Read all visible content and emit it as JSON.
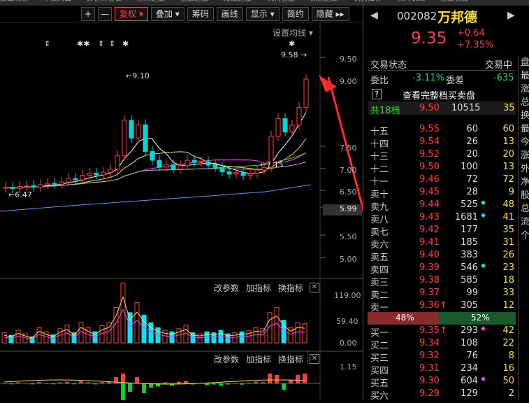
{
  "top_menu": [
    "盘面观测",
    "个股风云",
    "分析师看板",
    "东方选股",
    "信披选股",
    "短线选股",
    "机构看盘",
    "热点追踪",
    "机构推荐",
    "机构长线",
    "信披看盘"
  ],
  "toolbar": {
    "plus": "+",
    "minus": "—",
    "fuquan": "复权",
    "diejia": "叠加",
    "chouma": "筹码",
    "huaxian": "画线",
    "xianshi": "显示",
    "jianyue": "简约",
    "yincang": "隐藏"
  },
  "chart": {
    "settings_label": "设置均线",
    "price_axis": [
      "9.50",
      "9.00",
      "7.50",
      "7.00",
      "6.50",
      "5.99",
      "5.50",
      "5.00"
    ],
    "current_price_tag": "5.99",
    "annotations": {
      "high": "9.10",
      "low": "6.47",
      "low2": "7.15",
      "last": "9.58"
    },
    "markers": [
      "⇕",
      "✱✱",
      "⇕",
      "⇕",
      "✱",
      "✱"
    ],
    "vol_axis": [
      "119.00",
      "59.40",
      "0.00"
    ],
    "macd_axis": "1.15",
    "indicator_buttons": {
      "change": "改参数",
      "add": "加指标",
      "switch": "换指标",
      "close": "✕"
    }
  },
  "stock": {
    "code": "002082",
    "name": "万邦德",
    "price": "9.35",
    "change": "+0.64",
    "pct": "+7.35%"
  },
  "status": {
    "label": "交易状态",
    "value": "交易中"
  },
  "weibi": {
    "label": "委比",
    "value": "-3.11%",
    "cha_label": "委差",
    "cha_value": "-635"
  },
  "view_full": {
    "q": "?",
    "label": "查看完整档买卖盘"
  },
  "total": {
    "label": "共18档",
    "price": "9.50",
    "vol": "10515",
    "cnt": "35"
  },
  "asks": [
    {
      "n": "十五",
      "p": "9.55",
      "v": "60",
      "m": "",
      "c": "60"
    },
    {
      "n": "十四",
      "p": "9.54",
      "v": "26",
      "m": "",
      "c": "13"
    },
    {
      "n": "十三",
      "p": "9.52",
      "v": "20",
      "m": "",
      "c": "20"
    },
    {
      "n": "十二",
      "p": "9.50",
      "v": "100",
      "m": "",
      "c": "13"
    },
    {
      "n": "十一",
      "p": "9.46",
      "v": "72",
      "m": "",
      "c": "72"
    },
    {
      "n": "卖十",
      "p": "9.45",
      "v": "28",
      "m": "",
      "c": "9"
    },
    {
      "n": "卖九",
      "p": "9.44",
      "v": "525",
      "m": "◆",
      "c": "48"
    },
    {
      "n": "卖八",
      "p": "9.43",
      "v": "1681",
      "m": "◆",
      "c": "41"
    },
    {
      "n": "卖七",
      "p": "9.42",
      "v": "177",
      "m": "",
      "c": "35"
    },
    {
      "n": "卖六",
      "p": "9.41",
      "v": "185",
      "m": "",
      "c": "31"
    },
    {
      "n": "卖五",
      "p": "9.40",
      "v": "383",
      "m": "",
      "c": "26"
    },
    {
      "n": "卖四",
      "p": "9.39",
      "v": "546",
      "m": "◆",
      "c": "23"
    },
    {
      "n": "卖三",
      "p": "9.38",
      "v": "585",
      "m": "",
      "c": "18"
    },
    {
      "n": "卖二",
      "p": "9.37",
      "v": "99",
      "m": "",
      "c": "33"
    },
    {
      "n": "卖一",
      "p": "9.36↑",
      "v": "305",
      "m": "",
      "c": "12"
    }
  ],
  "ratio": {
    "sell": "48%",
    "buy": "52%",
    "sell_frac": 0.48
  },
  "bids": [
    {
      "n": "买一",
      "p": "9.35↑",
      "v": "293",
      "m": "◆",
      "c": "42"
    },
    {
      "n": "买二",
      "p": "9.34",
      "v": "108",
      "m": "",
      "c": "22"
    },
    {
      "n": "买三",
      "p": "9.32",
      "v": "76",
      "m": "",
      "c": "8"
    },
    {
      "n": "买四",
      "p": "9.31",
      "v": "234",
      "m": "",
      "c": "16"
    },
    {
      "n": "买五",
      "p": "9.30",
      "v": "604",
      "m": "◆",
      "c": "50"
    },
    {
      "n": "买六",
      "p": "9.29",
      "v": "129",
      "m": "",
      "c": "2"
    }
  ],
  "side_cut": [
    "盘",
    "最",
    "涨",
    "总",
    "换",
    "最",
    "今",
    "涨",
    "外",
    "净",
    "股",
    "总",
    "流",
    "个"
  ],
  "colors": {
    "up": "#ff3c3c",
    "down": "#00d0d0",
    "cyan": "#00e5ff",
    "yellow": "#ffe020",
    "green": "#3cd03c"
  }
}
